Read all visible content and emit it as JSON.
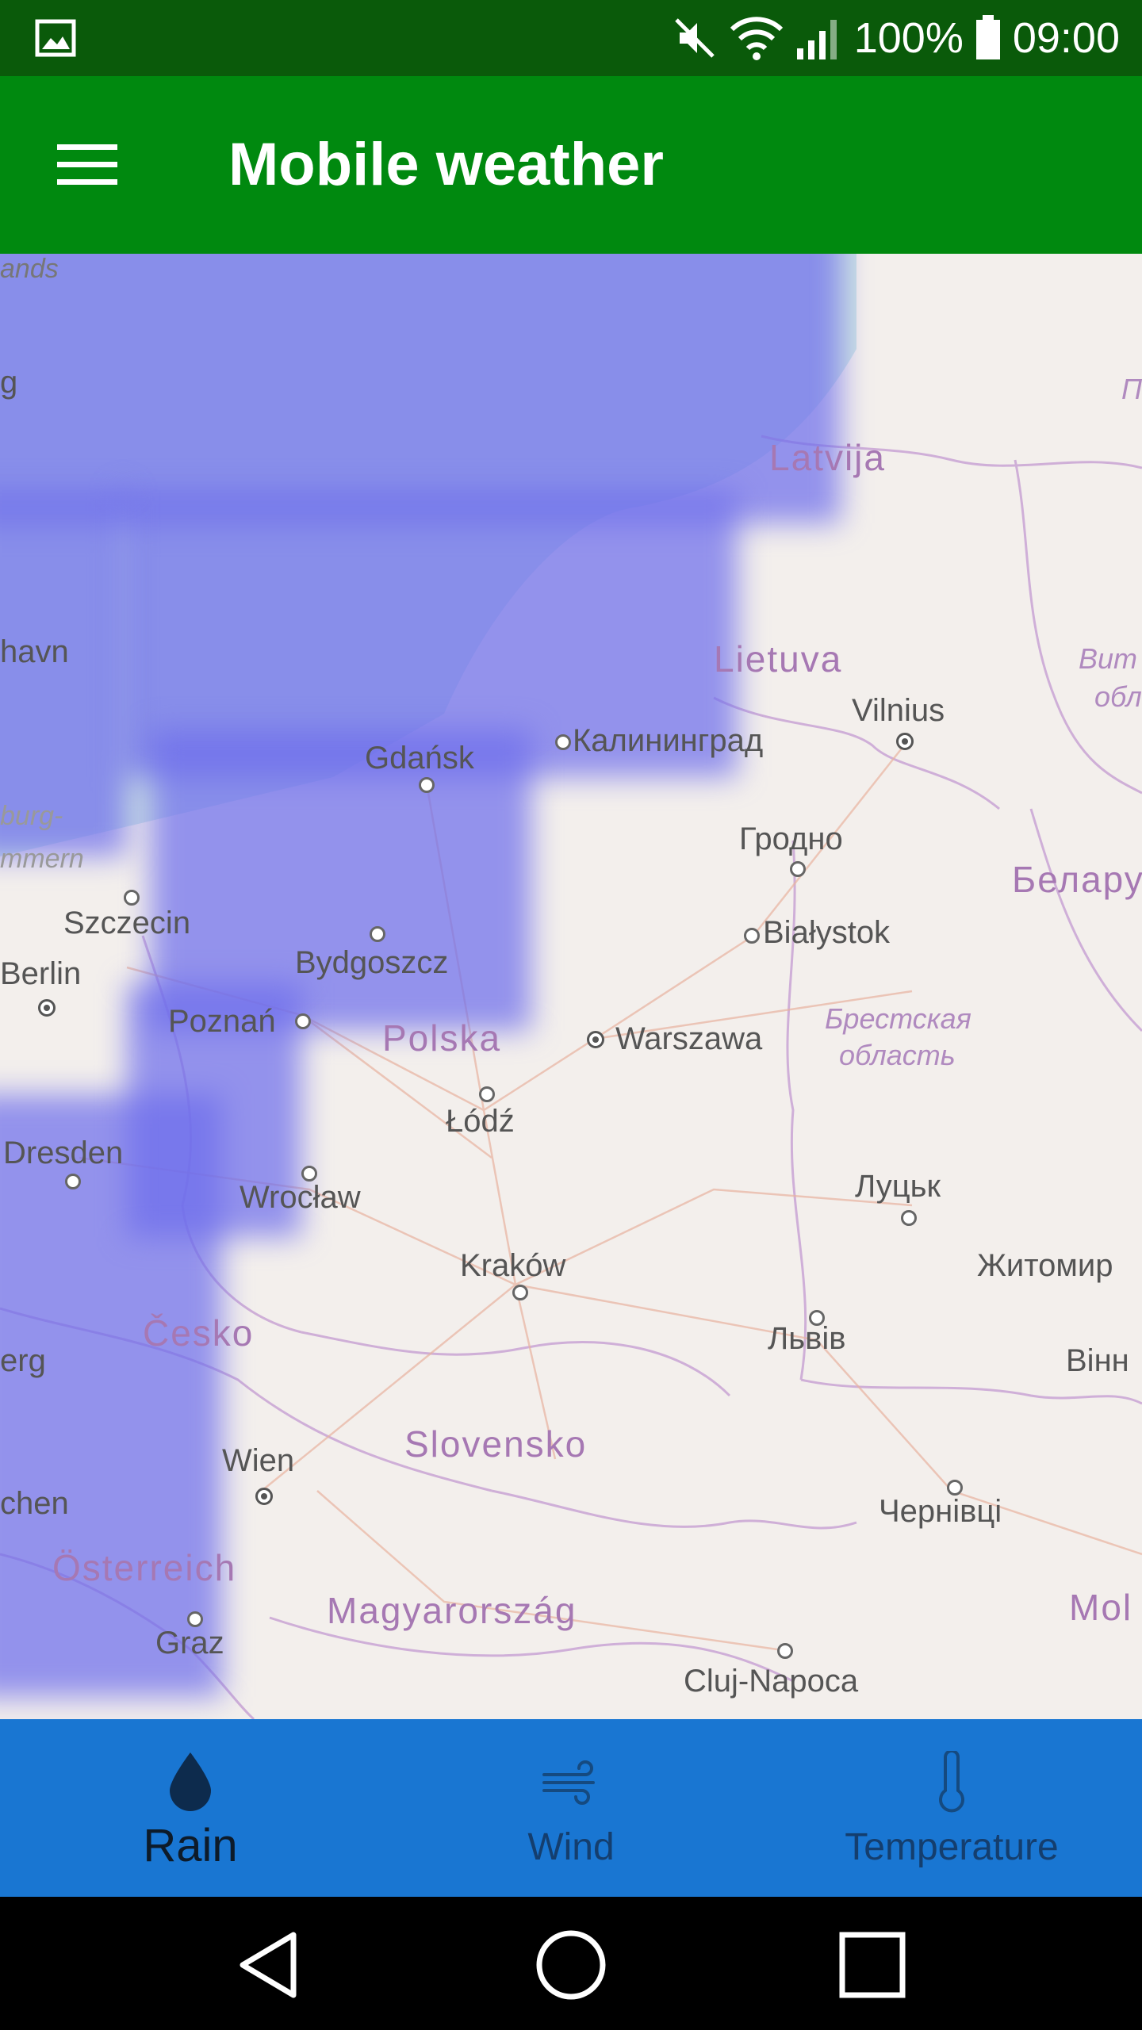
{
  "status_bar": {
    "battery": "100%",
    "time": "09:00",
    "icons": [
      "gallery-icon",
      "mute-icon",
      "wifi-icon",
      "signal-icon",
      "battery-icon"
    ]
  },
  "app_bar": {
    "title": "Mobile weather",
    "menu_icon": "hamburger-menu-icon"
  },
  "map": {
    "layer": "rain",
    "labels": {
      "havn": "havn",
      "ands": "ands",
      "g": "g",
      "burg": "burg-",
      "mmern": "mmern",
      "szczecin": "Szczecin",
      "berlin": "Berlin",
      "gdansk": "Gdańsk",
      "kaliningrad": "Калининград",
      "latvija": "Latvija",
      "lietuva": "Lietuva",
      "vilnius": "Vilnius",
      "grodno": "Гродно",
      "bialystok": "Białystok",
      "bydgoszcz": "Bydgoszcz",
      "poznan": "Poznań",
      "polska": "Polska",
      "warszawa": "Warszawa",
      "brest_region_1": "Брестская",
      "brest_region_2": "область",
      "belarus": "Белару",
      "lodz": "Łódź",
      "dresden": "Dresden",
      "wroclaw": "Wrocław",
      "lutsk": "Луцьк",
      "zhytomyr": "Житомир",
      "krakow": "Kraków",
      "cesko": "Česko",
      "erg": "erg",
      "lviv": "Львів",
      "vinn": "Вінн",
      "slovensko": "Slovensko",
      "wien": "Wien",
      "chen": "chen",
      "chernivtsi": "Чернівці",
      "osterreich": "Österreich",
      "magyarorszag": "Magyarország",
      "mol": "Mol",
      "graz": "Graz",
      "cluj": "Cluj-Napoca",
      "vit1": "Вит",
      "vit2": "обл",
      "p": "П"
    }
  },
  "bottom_nav": {
    "items": [
      {
        "label": "Rain",
        "icon": "raindrop-icon",
        "active": true
      },
      {
        "label": "Wind",
        "icon": "wind-icon",
        "active": false
      },
      {
        "label": "Temperature",
        "icon": "thermometer-icon",
        "active": false
      }
    ]
  },
  "system_nav": {
    "icons": [
      "back-icon",
      "home-icon",
      "recents-icon"
    ]
  }
}
